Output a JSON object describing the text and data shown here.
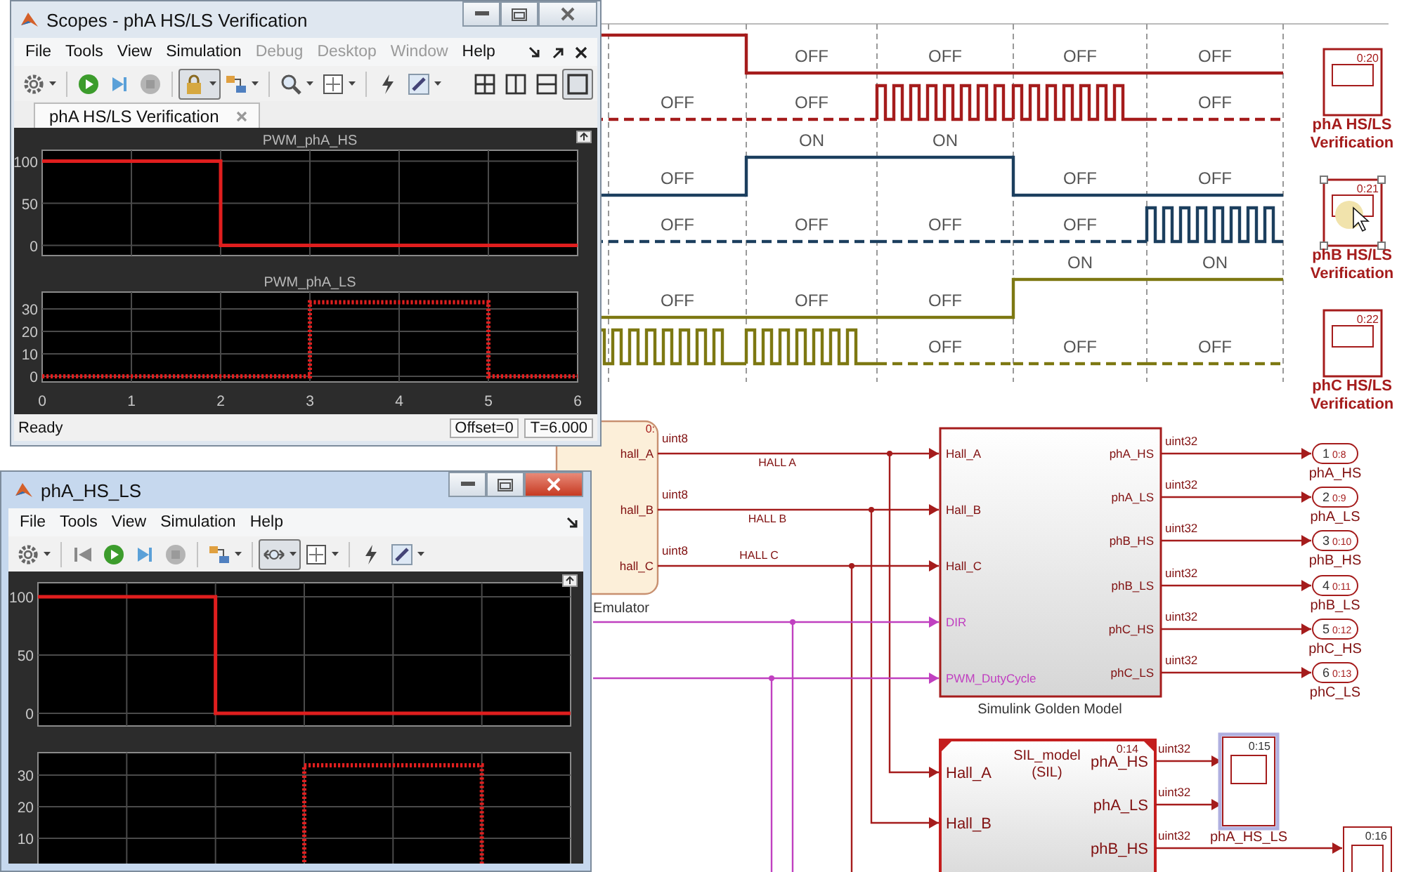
{
  "timing_diagram": {
    "signals": [
      {
        "color": "#a51c1c",
        "kind": "solid",
        "segments": [
          {
            "kind": "high"
          },
          {
            "kind": "low",
            "label": "OFF"
          },
          {
            "kind": "low",
            "label": "OFF"
          },
          {
            "kind": "low",
            "label": "OFF"
          },
          {
            "kind": "low",
            "label": "OFF"
          }
        ]
      },
      {
        "color": "#a51c1c",
        "kind": "dashed",
        "segments": [
          {
            "kind": "low",
            "label": "OFF"
          },
          {
            "kind": "low",
            "label": "OFF"
          },
          {
            "kind": "pwm"
          },
          {
            "kind": "pwm"
          },
          {
            "kind": "low",
            "label": "OFF"
          }
        ]
      },
      {
        "color": "#1c3f5e",
        "kind": "solid",
        "segments": [
          {
            "kind": "low",
            "label": "OFF"
          },
          {
            "kind": "high",
            "label": "ON"
          },
          {
            "kind": "high",
            "label": "ON"
          },
          {
            "kind": "low",
            "label": "OFF"
          },
          {
            "kind": "low",
            "label": "OFF"
          }
        ]
      },
      {
        "color": "#1c3f5e",
        "kind": "dashed",
        "segments": [
          {
            "kind": "low",
            "label": "OFF"
          },
          {
            "kind": "low",
            "label": "OFF"
          },
          {
            "kind": "low",
            "label": "OFF"
          },
          {
            "kind": "low",
            "label": "OFF"
          },
          {
            "kind": "pwm"
          }
        ]
      },
      {
        "color": "#7d7812",
        "kind": "solid",
        "segments": [
          {
            "kind": "low",
            "label": "OFF"
          },
          {
            "kind": "low",
            "label": "OFF"
          },
          {
            "kind": "low",
            "label": "OFF"
          },
          {
            "kind": "high",
            "label": "ON"
          },
          {
            "kind": "high",
            "label": "ON"
          }
        ]
      },
      {
        "color": "#7d7812",
        "kind": "dashed",
        "segments": [
          {
            "kind": "pwm"
          },
          {
            "kind": "pwm"
          },
          {
            "kind": "low",
            "label": "OFF"
          },
          {
            "kind": "low",
            "label": "OFF"
          },
          {
            "kind": "low",
            "label": "OFF"
          }
        ]
      }
    ]
  },
  "scope_blocks": [
    {
      "rate": "0:20",
      "label_lines": [
        "phA HS/LS",
        "Verification"
      ],
      "selected": false
    },
    {
      "rate": "0:21",
      "label_lines": [
        "phB HS/LS",
        "Verification"
      ],
      "selected": true
    },
    {
      "rate": "0:22",
      "label_lines": [
        "phC HS/LS",
        "Verification"
      ],
      "selected": false
    }
  ],
  "model": {
    "emulator": {
      "name": "Emulator",
      "rate": "0:",
      "ports": [
        {
          "label": "hall_A",
          "type": "uint8"
        },
        {
          "label": "hall_B",
          "type": "uint8"
        },
        {
          "label": "hall_C",
          "type": "uint8"
        }
      ]
    },
    "hall_signals": [
      "HALL A",
      "HALL B",
      "HALL C"
    ],
    "golden_model": {
      "name": "Simulink Golden Model",
      "inputs": [
        {
          "label": "Hall_A",
          "kind": "data"
        },
        {
          "label": "Hall_B",
          "kind": "data"
        },
        {
          "label": "Hall_C",
          "kind": "data"
        },
        {
          "label": "DIR",
          "kind": "control"
        },
        {
          "label": "PWM_DutyCycle",
          "kind": "control"
        }
      ],
      "outputs": [
        {
          "label": "phA_HS",
          "type": "uint32"
        },
        {
          "label": "phA_LS",
          "type": "uint32"
        },
        {
          "label": "phB_HS",
          "type": "uint32"
        },
        {
          "label": "phB_LS",
          "type": "uint32"
        },
        {
          "label": "phC_HS",
          "type": "uint32"
        },
        {
          "label": "phC_LS",
          "type": "uint32"
        }
      ]
    },
    "outports": [
      {
        "number": "1",
        "rate": "0:8",
        "label": "phA_HS"
      },
      {
        "number": "2",
        "rate": "0:9",
        "label": "phA_LS"
      },
      {
        "number": "3",
        "rate": "0:10",
        "label": "phB_HS"
      },
      {
        "number": "4",
        "rate": "0:11",
        "label": "phB_LS"
      },
      {
        "number": "5",
        "rate": "0:12",
        "label": "phC_HS"
      },
      {
        "number": "6",
        "rate": "0:13",
        "label": "phC_LS"
      }
    ],
    "sil_model": {
      "title_lines": [
        "SIL_model",
        "(SIL)"
      ],
      "rate": "0:14",
      "inputs": [
        "Hall_A",
        "Hall_B"
      ],
      "outputs": [
        {
          "label": "phA_HS",
          "type": "uint32"
        },
        {
          "label": "phA_LS",
          "type": "uint32"
        },
        {
          "label": "phB_HS",
          "type": "uint32"
        }
      ]
    },
    "scopes": [
      {
        "rate": "0:15",
        "label": "phA_HS_LS",
        "selected": true
      },
      {
        "rate": "0:16",
        "selected": false
      }
    ]
  },
  "scope_windows": [
    {
      "title": "Scopes - phA HS/LS Verification",
      "active": false,
      "menu": [
        {
          "label": "File",
          "disabled": false
        },
        {
          "label": "Tools",
          "disabled": false
        },
        {
          "label": "View",
          "disabled": false
        },
        {
          "label": "Simulation",
          "disabled": false
        },
        {
          "label": "Debug",
          "disabled": true
        },
        {
          "label": "Desktop",
          "disabled": true
        },
        {
          "label": "Window",
          "disabled": true
        },
        {
          "label": "Help",
          "disabled": false
        }
      ],
      "toolbar": [
        [
          {
            "kind": "gear",
            "dropdown": true,
            "pressed": false
          }
        ],
        [
          {
            "kind": "play",
            "dropdown": false,
            "pressed": false
          },
          {
            "kind": "step",
            "dropdown": false,
            "pressed": false
          },
          {
            "kind": "stop",
            "dropdown": false,
            "pressed": false
          }
        ],
        [
          {
            "kind": "lock",
            "dropdown": true,
            "pressed": true
          },
          {
            "kind": "blocks",
            "dropdown": true,
            "pressed": false
          }
        ],
        [
          {
            "kind": "zoom",
            "dropdown": true,
            "pressed": false
          },
          {
            "kind": "fit",
            "dropdown": true,
            "pressed": false
          }
        ],
        [
          {
            "kind": "trigger",
            "dropdown": false,
            "pressed": false
          },
          {
            "kind": "pen",
            "dropdown": true,
            "pressed": false
          }
        ]
      ],
      "layouts": [
        {
          "kind": "grid",
          "pressed": false
        },
        {
          "kind": "columns",
          "pressed": false
        },
        {
          "kind": "rows",
          "pressed": false
        },
        {
          "kind": "single",
          "pressed": true
        }
      ],
      "tabs": [
        {
          "label": "phA HS/LS Verification"
        }
      ],
      "plots": [
        {
          "chart_data": {
            "type": "line",
            "title": "PWM_phA_HS",
            "x": [
              0,
              2,
              2,
              6
            ],
            "series": [
              {
                "color": "#e01e1e",
                "line_style": "solid",
                "values": [
                  100,
                  100,
                  0,
                  0
                ]
              }
            ],
            "xlim": [
              0,
              6
            ],
            "ylim": [
              -12,
              113
            ],
            "yticks": [
              0,
              50,
              100
            ],
            "grid": true
          }
        },
        {
          "chart_data": {
            "type": "line",
            "title": "PWM_phA_LS",
            "x": [
              0,
              3,
              3,
              5,
              5,
              6
            ],
            "series": [
              {
                "color": "#e01e1e",
                "line_style": "dotted",
                "values": [
                  0,
                  0,
                  33,
                  33,
                  0,
                  0
                ]
              }
            ],
            "xlim": [
              0,
              6
            ],
            "ylim": [
              -2.5,
              37.5
            ],
            "xticks": [
              0,
              1,
              2,
              3,
              4,
              5,
              6
            ],
            "yticks": [
              0,
              10,
              20,
              30
            ],
            "grid": true
          }
        }
      ],
      "status_bar": {
        "text": "Ready",
        "offset": "Offset=0",
        "time": "T=6.000"
      }
    },
    {
      "title": "phA_HS_LS",
      "active": true,
      "menu": [
        {
          "label": "File",
          "disabled": false
        },
        {
          "label": "Tools",
          "disabled": false
        },
        {
          "label": "View",
          "disabled": false
        },
        {
          "label": "Simulation",
          "disabled": false
        },
        {
          "label": "Help",
          "disabled": false
        }
      ],
      "toolbar": [
        [
          {
            "kind": "gear",
            "dropdown": true,
            "pressed": false
          }
        ],
        [
          {
            "kind": "back",
            "dropdown": false,
            "pressed": false
          },
          {
            "kind": "play",
            "dropdown": false,
            "pressed": false
          },
          {
            "kind": "step",
            "dropdown": false,
            "pressed": false
          },
          {
            "kind": "stop",
            "dropdown": false,
            "pressed": false
          }
        ],
        [
          {
            "kind": "blocks",
            "dropdown": true,
            "pressed": false
          }
        ],
        [
          {
            "kind": "zoomx",
            "dropdown": true,
            "pressed": true
          },
          {
            "kind": "fit",
            "dropdown": true,
            "pressed": false
          }
        ],
        [
          {
            "kind": "trigger",
            "dropdown": false,
            "pressed": false
          },
          {
            "kind": "pen",
            "dropdown": true,
            "pressed": false
          }
        ]
      ],
      "plots": [
        {
          "kind": "step-down",
          "y_tick_labels": [
            "100",
            "50",
            "0"
          ]
        },
        {
          "kind": "pulse",
          "y_tick_labels": [
            "30",
            "20",
            "10"
          ]
        }
      ]
    }
  ]
}
